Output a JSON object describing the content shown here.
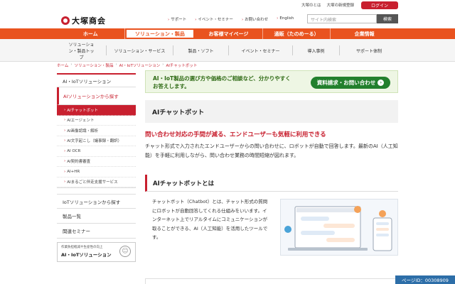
{
  "util": {
    "links": [
      "大塚のとは",
      "大塚の新規登録"
    ],
    "login_label": "ログイン"
  },
  "header": {
    "logo_text": "大塚商会",
    "links": [
      "サポート",
      "イベント・セミナー",
      "お問い合わせ",
      "English"
    ],
    "search_placeholder": "サイト内検索",
    "search_button": "検索"
  },
  "mainnav": [
    {
      "label": "ホーム"
    },
    {
      "label": "ソリューション・製品"
    },
    {
      "label": "お客様マイページ"
    },
    {
      "label": "通販（たのめーる）"
    },
    {
      "label": "企業情報"
    }
  ],
  "subnav": [
    "ソリューション・製品トップ",
    "ソリューション・サービス",
    "製品・ソフト",
    "イベント・セミナー",
    "導入事例",
    "サポート体制"
  ],
  "breadcrumbs": [
    "ホーム",
    "ソリューション・製品",
    "AI・IoTソリューション",
    "AIチャットボット"
  ],
  "sidebar": {
    "title": "AI・IoTソリューション",
    "section": "AIソリューションから探す",
    "subitems": [
      "AIチャットボット",
      "AIエージェント",
      "AI画像認識・解析",
      "AI文字起こし（議事録・翻訳）",
      "AI OCR",
      "AI契約書審査",
      "AI+HR",
      "AIまるごと伴走支援サービス"
    ],
    "items": [
      "IoTソリューションから探す",
      "製品一覧",
      "関連セミナー"
    ],
    "banner_small": "作業負担軽減や生産性の向上",
    "banner_big": "AI・IoTソリューション"
  },
  "main": {
    "cta_message": "AI・IoT製品の選び方や価格のご相談など、分かりやすくお答えします。",
    "cta_button": "資料請求・お問い合わせ",
    "page_title": "AIチャットボット",
    "lead": "問い合わせ対応の手間が減る、エンドユーザーも気軽に利用できる",
    "intro": "チャット形式で入力されたエンドユーザーからの問い合わせに、ロボットが自動で回答します。最新のAI（人工知能）を手軽に利用しながら、問い合わせ業務の時間短縮が図れます。",
    "section_title": "AIチャットボットとは",
    "section_text": "チャットボット（Chatbot）とは、チャット形式の質問にロボットが自動回答してくれる仕組みをいいます。インターネット上でリアルタイムにコミュニケーションが取ることができる、AI（人工知能）を活用したツールです。"
  },
  "page_id": "ページID：00308909",
  "colors": {
    "brand_red": "#c8202f",
    "nav_orange": "#e9531f",
    "cta_green": "#22802d",
    "pageid_blue": "#2d6ea8"
  }
}
